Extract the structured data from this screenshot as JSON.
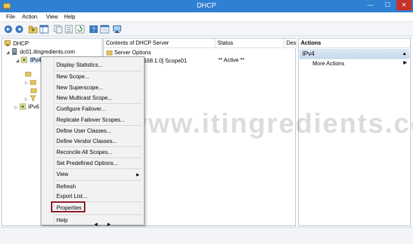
{
  "window": {
    "title": "DHCP",
    "minimize_glyph": "—",
    "maximize_glyph": "☐",
    "close_glyph": "✕"
  },
  "menubar": {
    "file": "File",
    "action": "Action",
    "view": "View",
    "help": "Help"
  },
  "toolbar": {
    "icons": [
      "back-icon",
      "forward-icon",
      "up-folder-icon",
      "show-hide-tree-icon",
      "copy-icon",
      "export-list-icon",
      "refresh-icon",
      "help-icon",
      "properties-icon",
      "monitor-icon"
    ]
  },
  "tree": {
    "root": "DHCP",
    "server": "dc01.itingredients.com",
    "ipv4": "IPv4",
    "ipv6": "IPv6"
  },
  "list": {
    "columns": [
      "Contents of DHCP Server",
      "Status",
      "Des"
    ],
    "rows": [
      {
        "name": "Server Options",
        "status": ""
      },
      {
        "name": "Scope [192.168.1.0] Scope01",
        "status": "** Active **"
      }
    ]
  },
  "actions": {
    "header": "Actions",
    "group": "IPv4",
    "more": "More Actions"
  },
  "context_menu": {
    "items": [
      "Display Statistics...",
      "New Scope...",
      "New Superscope...",
      "New Multicast Scope...",
      "Configure Failover...",
      "Replicate Failover Scopes...",
      "Define User Classes...",
      "Define Vendor Classes...",
      "Reconcile All Scopes...",
      "Set Predefined Options...",
      "View",
      "Refresh",
      "Export List...",
      "Properties",
      "Help"
    ],
    "highlighted": "Properties"
  },
  "watermark": "www.itingredients.com",
  "colors": {
    "titlebar": "#2f7fd3",
    "close": "#c7312a",
    "highlight_border": "#8b0e1f"
  }
}
